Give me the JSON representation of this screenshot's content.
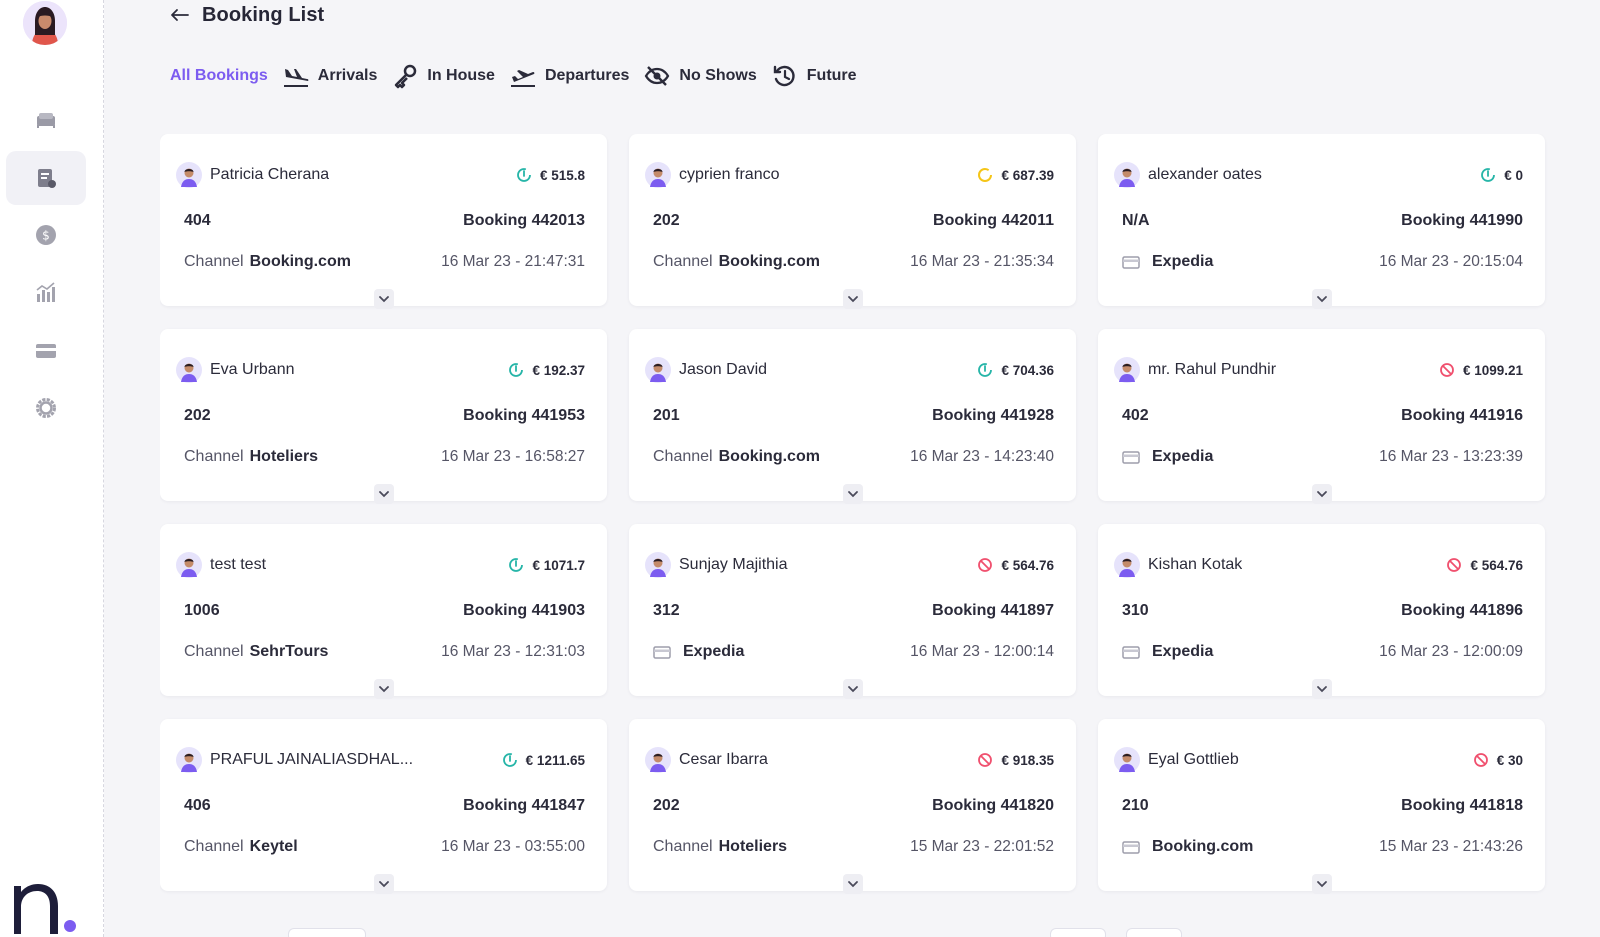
{
  "header": {
    "title": "Booking List"
  },
  "tabs": [
    {
      "label": "All Bookings",
      "icon": "none",
      "active": true
    },
    {
      "label": "Arrivals",
      "icon": "plane-landing-icon",
      "active": false
    },
    {
      "label": "In House",
      "icon": "key-icon",
      "active": false
    },
    {
      "label": "Departures",
      "icon": "plane-takeoff-icon",
      "active": false
    },
    {
      "label": "No Shows",
      "icon": "eye-off-icon",
      "active": false
    },
    {
      "label": "Future",
      "icon": "clock-history-icon",
      "active": false
    }
  ],
  "sidebar": {
    "items": [
      {
        "icon": "bed-icon",
        "active": false
      },
      {
        "icon": "booking-list-icon",
        "active": true
      },
      {
        "icon": "dollar-coin-icon",
        "active": false
      },
      {
        "icon": "chart-bars-icon",
        "active": false
      },
      {
        "icon": "credit-card-icon",
        "active": false
      },
      {
        "icon": "settings-gear-icon",
        "active": false
      }
    ]
  },
  "colors": {
    "accent": "#7c5cf0",
    "status_confirmed": "#26b5a8",
    "status_pending": "#f5c518",
    "status_cancelled": "#f0506e"
  },
  "bookings": [
    {
      "name": "Patricia Cherana",
      "status": "confirmed",
      "amount": "€ 515.8",
      "room": "404",
      "booking": "Booking 442013",
      "channel_label": "Channel",
      "channel": "Booking.com",
      "datetime": "16 Mar 23 - 21:47:31"
    },
    {
      "name": "cyprien franco",
      "status": "pending",
      "amount": "€ 687.39",
      "room": "202",
      "booking": "Booking 442011",
      "channel_label": "Channel",
      "channel": "Booking.com",
      "datetime": "16 Mar 23 - 21:35:34"
    },
    {
      "name": "alexander oates",
      "status": "confirmed",
      "amount": "€ 0",
      "room": "N/A",
      "booking": "Booking 441990",
      "channel_label": "",
      "channel": "Expedia",
      "datetime": "16 Mar 23 - 20:15:04"
    },
    {
      "name": "Eva Urbann",
      "status": "confirmed",
      "amount": "€ 192.37",
      "room": "202",
      "booking": "Booking 441953",
      "channel_label": "Channel",
      "channel": "Hoteliers",
      "datetime": "16 Mar 23 - 16:58:27"
    },
    {
      "name": "Jason David",
      "status": "confirmed",
      "amount": "€ 704.36",
      "room": "201",
      "booking": "Booking 441928",
      "channel_label": "Channel",
      "channel": "Booking.com",
      "datetime": "16 Mar 23 - 14:23:40"
    },
    {
      "name": "mr. Rahul Pundhir",
      "status": "cancelled",
      "amount": "€ 1099.21",
      "room": "402",
      "booking": "Booking 441916",
      "channel_label": "",
      "channel": "Expedia",
      "datetime": "16 Mar 23 - 13:23:39"
    },
    {
      "name": "test test",
      "status": "confirmed",
      "amount": "€ 1071.7",
      "room": "1006",
      "booking": "Booking 441903",
      "channel_label": "Channel",
      "channel": "SehrTours",
      "datetime": "16 Mar 23 - 12:31:03"
    },
    {
      "name": "Sunjay Majithia",
      "status": "cancelled",
      "amount": "€ 564.76",
      "room": "312",
      "booking": "Booking 441897",
      "channel_label": "",
      "channel": "Expedia",
      "datetime": "16 Mar 23 - 12:00:14"
    },
    {
      "name": "Kishan Kotak",
      "status": "cancelled",
      "amount": "€ 564.76",
      "room": "310",
      "booking": "Booking 441896",
      "channel_label": "",
      "channel": "Expedia",
      "datetime": "16 Mar 23 - 12:00:09"
    },
    {
      "name": "PRAFUL JAINALIASDHAL...",
      "status": "confirmed",
      "amount": "€ 1211.65",
      "room": "406",
      "booking": "Booking 441847",
      "channel_label": "Channel",
      "channel": "Keytel",
      "datetime": "16 Mar 23 - 03:55:00"
    },
    {
      "name": "Cesar Ibarra",
      "status": "cancelled",
      "amount": "€ 918.35",
      "room": "202",
      "booking": "Booking 441820",
      "channel_label": "Channel",
      "channel": "Hoteliers",
      "datetime": "15 Mar 23 - 22:01:52"
    },
    {
      "name": "Eyal Gottlieb",
      "status": "cancelled",
      "amount": "€ 30",
      "room": "210",
      "booking": "Booking 441818",
      "channel_label": "",
      "channel": "Booking.com",
      "datetime": "15 Mar 23 - 21:43:26"
    }
  ]
}
